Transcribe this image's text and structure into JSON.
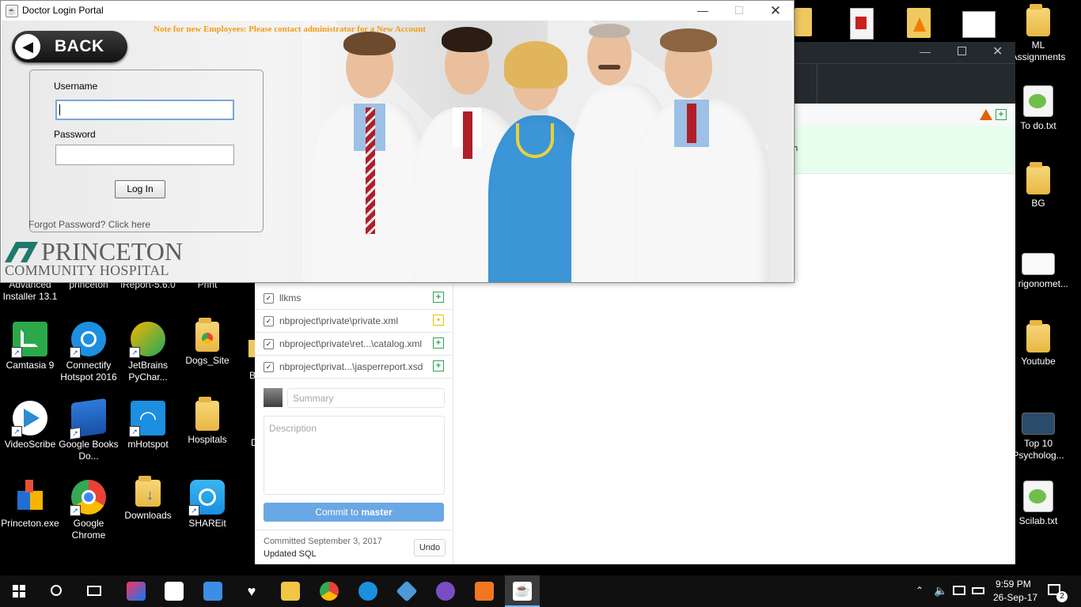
{
  "desktop": {
    "right_icons": [
      {
        "label": "ML Assignments"
      },
      {
        "label": "To do.txt"
      },
      {
        "label": "BG"
      },
      {
        "label": "rigonomet..."
      },
      {
        "label": "Youtube"
      },
      {
        "label": "Top 10 Psycholog..."
      },
      {
        "label": "Scilab.txt"
      }
    ],
    "left_icons_row1": [
      {
        "label": "Advanced Installer 13.1"
      },
      {
        "label": "princeton"
      },
      {
        "label": "iReport-5.6.0"
      },
      {
        "label": "Print"
      }
    ],
    "left_icons_row2": [
      {
        "label": "Camtasia 9"
      },
      {
        "label": "Connectify Hotspot 2016"
      },
      {
        "label": "JetBrains PyChar..."
      },
      {
        "label": "Dogs_Site"
      }
    ],
    "left_icons_row3": [
      {
        "label": "VideoScribe"
      },
      {
        "label": "Google Books Do..."
      },
      {
        "label": "mHotspot"
      },
      {
        "label": "Hospitals"
      }
    ],
    "left_icons_row4": [
      {
        "label": "Princeton.exe"
      },
      {
        "label": "Google Chrome"
      },
      {
        "label": "Downloads"
      },
      {
        "label": "SHAREit"
      }
    ]
  },
  "github_window": {
    "diff_text": "tion",
    "files": [
      {
        "name": "llkms",
        "status": "added"
      },
      {
        "name": "nbproject\\private\\private.xml",
        "status": "modified"
      },
      {
        "name": "nbproject\\private\\ret...\\catalog.xml",
        "status": "added"
      },
      {
        "name": "nbproject\\privat...\\jasperreport.xsd",
        "status": "added"
      }
    ],
    "summary_placeholder": "Summary",
    "description_placeholder": "Description",
    "commit_prefix": "Commit to ",
    "commit_branch": "master",
    "last_commit_date": "Committed September 3, 2017",
    "last_commit_message": "Updated SQL",
    "undo_label": "Undo"
  },
  "login_window": {
    "title": "Doctor Login Portal",
    "note": "Note for new Employees: Please contact administrator for a New Account",
    "back_label": "BACK",
    "username_label": "Username",
    "username_value": "",
    "password_label": "Password",
    "password_value": "",
    "login_label": "Log In",
    "forgot_label": "Forgot Password? Click here",
    "logo_line1": "PRINCETON",
    "logo_line2": "COMMUNITY HOSPITAL"
  },
  "taskbar": {
    "time": "9:59 PM",
    "date": "26-Sep-17",
    "notification_count": "2"
  },
  "colors": {
    "accent_orange": "#f39c12",
    "commit_blue": "#6aa7e5",
    "github_dark": "#24292e"
  }
}
